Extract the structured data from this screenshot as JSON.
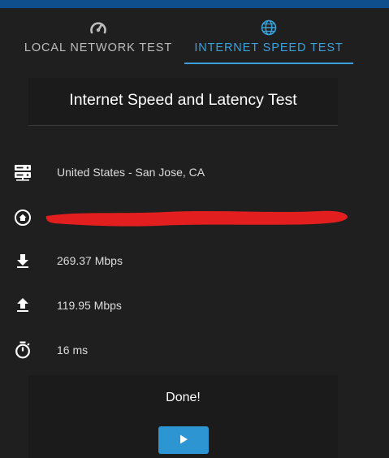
{
  "tabs": [
    {
      "label": "LOCAL NETWORK TEST",
      "icon": "speedometer-icon",
      "active": false
    },
    {
      "label": "INTERNET SPEED TEST",
      "icon": "globe-icon",
      "active": true
    }
  ],
  "card": {
    "title": "Internet Speed and Latency Test"
  },
  "results": {
    "server": {
      "icon": "server-icon",
      "value": "United States - San Jose, CA"
    },
    "home": {
      "icon": "home-icon",
      "value": ""
    },
    "download": {
      "icon": "download-icon",
      "value": "269.37 Mbps"
    },
    "upload": {
      "icon": "upload-icon",
      "value": "119.95 Mbps"
    },
    "latency": {
      "icon": "stopwatch-icon",
      "value": "16 ms"
    }
  },
  "status": {
    "text": "Done!"
  },
  "start_button": {
    "icon": "play-icon"
  },
  "colors": {
    "accent": "#3aa0dc",
    "button": "#2e95d3",
    "redaction": "#e31e1e",
    "background": "#1f1f1f"
  }
}
